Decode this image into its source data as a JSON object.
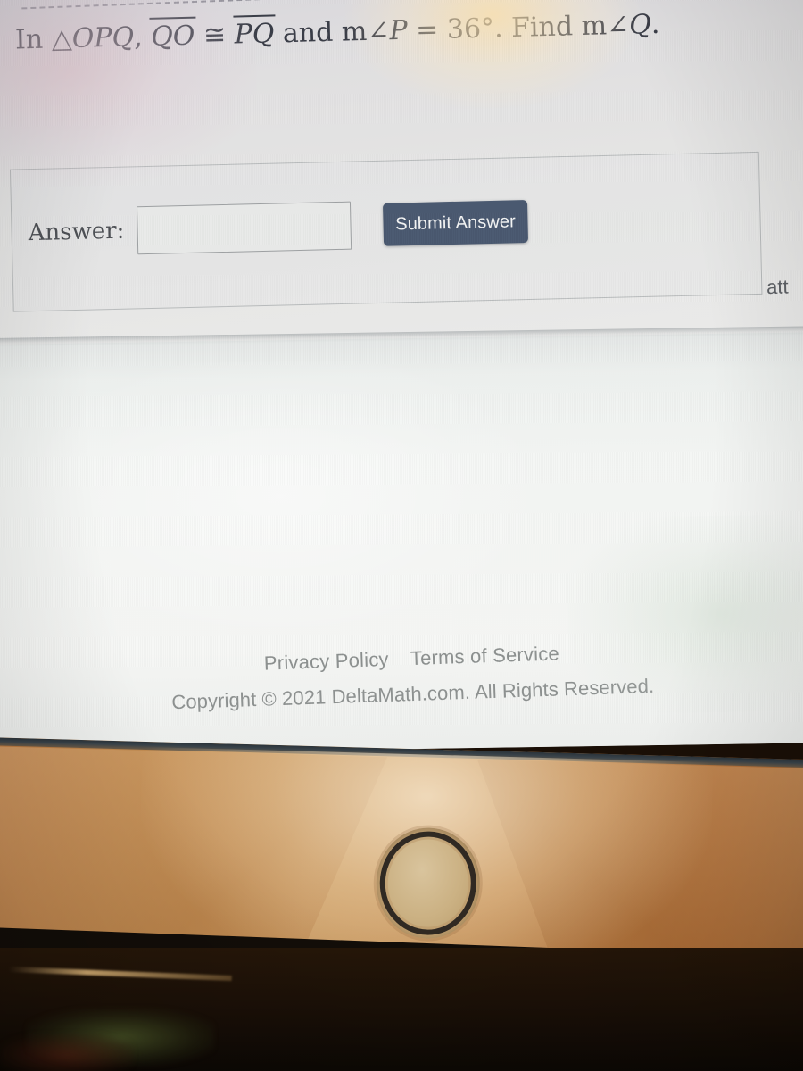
{
  "problem": {
    "prefix": "In",
    "triangle_symbol": "△",
    "triangle_name": "OPQ",
    "comma": ",",
    "segment1": "QO",
    "congruent_symbol": "≅",
    "segment2": "PQ",
    "conjunction": "and",
    "measure_prefix": "m",
    "angle_symbol": "∠",
    "angle1": "P",
    "equals": "=",
    "value": "36",
    "degree_symbol": "°",
    "period": ".",
    "find_word": "Find",
    "measure_prefix2": "m",
    "angle_symbol2": "∠",
    "angle2": "Q",
    "end_period": "."
  },
  "answer_panel": {
    "label": "Answer:",
    "input_value": "",
    "input_placeholder": "",
    "submit_label": "Submit Answer",
    "cutoff_text": "att"
  },
  "footer": {
    "privacy_label": "Privacy Policy",
    "terms_label": "Terms of Service",
    "copyright": "Copyright © 2021 DeltaMath.com. All Rights Reserved."
  },
  "colors": {
    "submit_button": "#4a5970",
    "page_background": "#f4f6f4",
    "panel_border": "#b9bcbd",
    "text": "#3a3d47",
    "footer_text": "#8d9190",
    "bezel": "#c2a273"
  }
}
